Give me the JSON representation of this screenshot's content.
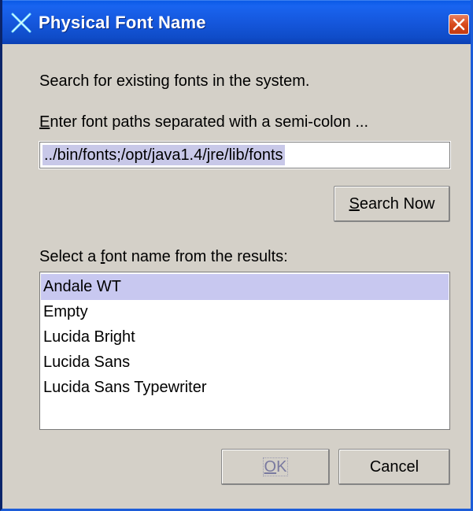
{
  "window": {
    "title": "Physical Font Name",
    "icons": {
      "app": "x-logo-icon",
      "close": "close-icon"
    }
  },
  "search": {
    "description": "Search for existing fonts in the system.",
    "paths_label_mnemonic": "E",
    "paths_label_rest": "nter font paths separated with a semi-colon ...",
    "paths_value": "../bin/fonts;/opt/java1.4/jre/lib/fonts",
    "button_mnemonic": "S",
    "button_rest": "earch Now"
  },
  "results": {
    "label_pre": "Select a ",
    "label_mnemonic": "f",
    "label_post": "ont name from the results:",
    "items": [
      {
        "label": "Andale WT",
        "selected": true
      },
      {
        "label": "Empty",
        "selected": false
      },
      {
        "label": "Lucida Bright",
        "selected": false
      },
      {
        "label": "Lucida Sans",
        "selected": false
      },
      {
        "label": "Lucida Sans Typewriter",
        "selected": false
      }
    ]
  },
  "buttons": {
    "ok_mnemonic": "O",
    "ok_rest": "K",
    "cancel": "Cancel"
  },
  "colors": {
    "titlebar": "#1557dc",
    "dialog_bg": "#d4d0c8",
    "selection": "#c8c8f0",
    "close_button": "#d84a1c"
  }
}
